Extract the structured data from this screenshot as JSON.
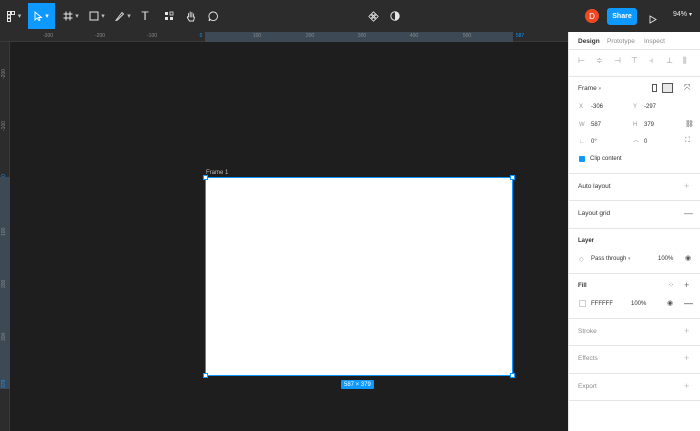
{
  "toolbar": {
    "tools": [
      {
        "name": "main-menu",
        "icon": "figma-logo-icon"
      },
      {
        "name": "move-tool",
        "icon": "cursor-icon",
        "active": true
      },
      {
        "name": "frame-tool",
        "icon": "hash-icon"
      },
      {
        "name": "shape-tool",
        "icon": "rectangle-icon"
      },
      {
        "name": "pen-tool",
        "icon": "pen-icon"
      },
      {
        "name": "text-tool",
        "icon": "text-icon",
        "glyph": "T"
      },
      {
        "name": "resources-tool",
        "icon": "grid-icon"
      },
      {
        "name": "hand-tool",
        "icon": "hand-icon"
      },
      {
        "name": "comment-tool",
        "icon": "comment-icon"
      }
    ],
    "avatar_initial": "D",
    "share_label": "Share",
    "zoom_label": "94%"
  },
  "ruler": {
    "top_ticks": [
      "-300",
      "-200",
      "-100",
      "0",
      "100",
      "200",
      "300",
      "400",
      "500",
      "587"
    ],
    "left_ticks": [
      "-200",
      "-100",
      "0",
      "100",
      "200",
      "300",
      "379"
    ]
  },
  "canvas": {
    "frame_name": "Frame 1",
    "frame_size_label": "587 × 379",
    "frame_fill": "#FFFFFF",
    "selection_color": "#0d99ff"
  },
  "panel": {
    "tabs": [
      "Design",
      "Prototype",
      "Inspect"
    ],
    "frame_label": "Frame",
    "x_label": "X",
    "x_value": "-306",
    "y_label": "Y",
    "y_value": "-297",
    "w_label": "W",
    "w_value": "587",
    "h_label": "H",
    "h_value": "379",
    "rotation_value": "0°",
    "radius_value": "0",
    "clip_content_label": "Clip content",
    "auto_layout_label": "Auto layout",
    "layout_grid_label": "Layout grid",
    "layer_label": "Layer",
    "blend_mode": "Pass through",
    "layer_opacity": "100%",
    "fill_label": "Fill",
    "fill_hex": "FFFFFF",
    "fill_opacity": "100%",
    "stroke_label": "Stroke",
    "effects_label": "Effects",
    "export_label": "Export"
  }
}
